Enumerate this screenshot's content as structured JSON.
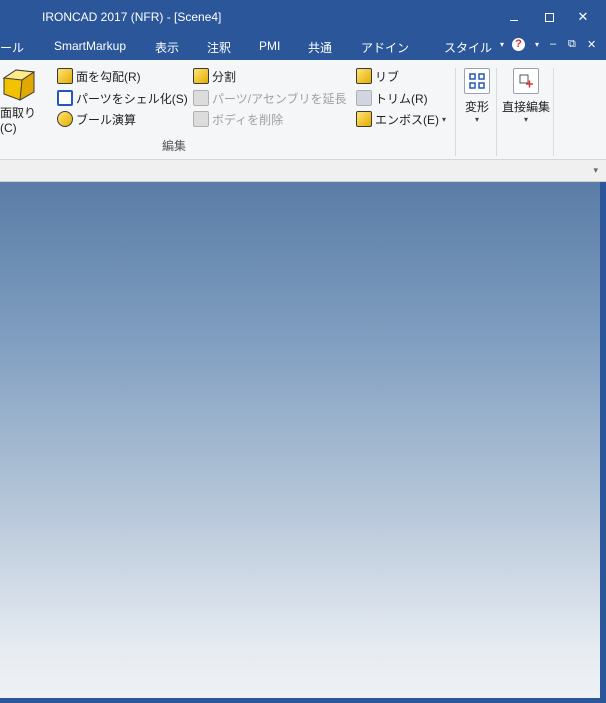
{
  "window": {
    "title": "IRONCAD 2017 (NFR) - [Scene4]",
    "minimize": "minimize",
    "maximize": "maximize",
    "close": "✕"
  },
  "menu": {
    "tabs": [
      "ール",
      "SmartMarkup",
      "表示",
      "注釈",
      "PMI",
      "共通",
      "アドイン",
      "スタイル"
    ],
    "style_caret": "▾",
    "help_caret": "▾",
    "doc_min": "‒",
    "doc_restore": "⧉",
    "doc_close": "✕",
    "help": "?"
  },
  "ribbon": {
    "chamfer_label": "面取り(C)",
    "commands": {
      "face_draft": "面を勾配(R)",
      "shell_part": "パーツをシェル化(S)",
      "boolean": "ブール演算",
      "split": "分割",
      "extend_part": "パーツ/アセンブリを延長",
      "delete_body": "ボディを削除",
      "rib": "リブ",
      "trim": "トリム(R)",
      "emboss": "エンボス(E)"
    },
    "group_label": "編集",
    "transform_label": "変形",
    "direct_edit_label": "直接編集",
    "caret": "▾"
  },
  "icons": {
    "chamfer": "chamfer-cube-icon",
    "face_draft": "face-draft-icon",
    "shell_part": "shell-icon",
    "boolean": "boolean-icon",
    "split": "split-icon",
    "extend_part": "extend-icon",
    "delete_body": "delete-body-icon",
    "rib": "rib-icon",
    "trim": "trim-icon",
    "emboss": "emboss-icon",
    "transform": "transform-icon",
    "direct_edit": "direct-edit-icon"
  },
  "colors": {
    "titlebar": "#2b579a",
    "ribbon_bg": "#f5f6f7",
    "viewport_top": "#5a7ca6",
    "viewport_bottom": "#eef1f5"
  }
}
